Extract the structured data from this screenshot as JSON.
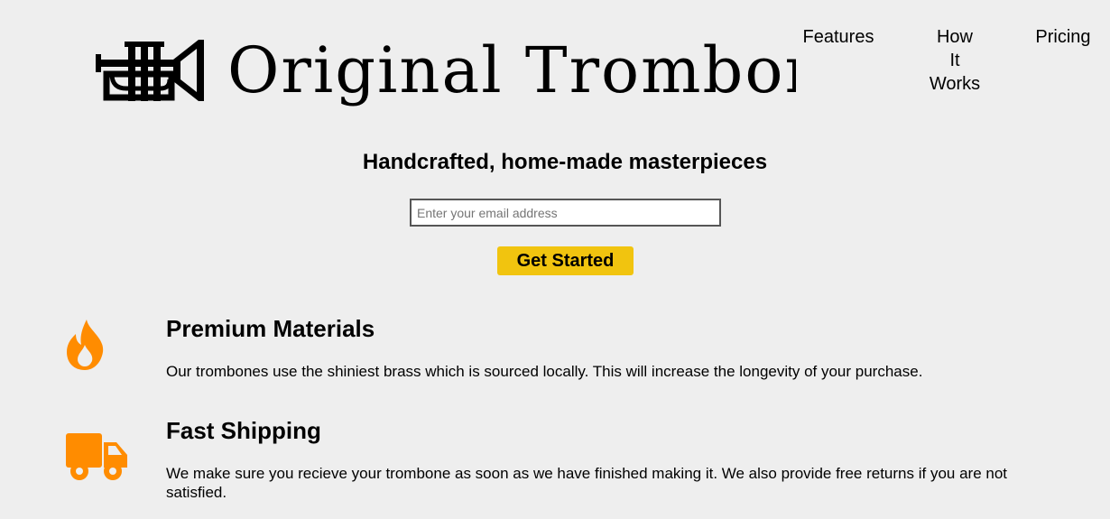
{
  "header": {
    "brand": "Original Trombones",
    "logo_icon": "trumpet-icon",
    "nav": {
      "features": "Features",
      "how_it_works_line1": "How",
      "how_it_works_line2": "It",
      "how_it_works_line3": "Works",
      "pricing": "Pricing"
    }
  },
  "hero": {
    "title": "Handcrafted, home-made masterpieces",
    "email_placeholder": "Enter your email address",
    "cta_label": "Get Started",
    "cta_color": "#f1c40f"
  },
  "features": {
    "accent_color": "#ff8c00",
    "items": [
      {
        "icon": "flame-icon",
        "title": "Premium Materials",
        "description": "Our trombones use the shiniest brass which is sourced locally. This will increase the longevity of your purchase."
      },
      {
        "icon": "truck-icon",
        "title": "Fast Shipping",
        "description": "We make sure you recieve your trombone as soon as we have finished making it. We also provide free returns if you are not satisfied."
      }
    ]
  }
}
